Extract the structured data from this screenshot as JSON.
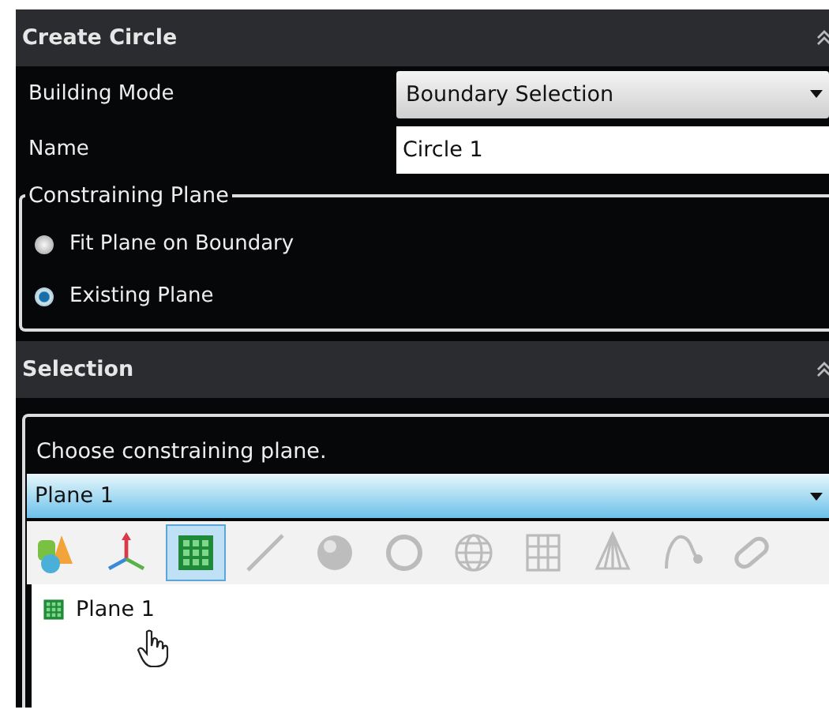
{
  "create_panel": {
    "title": "Create Circle",
    "building_mode": {
      "label": "Building Mode",
      "value": "Boundary Selection"
    },
    "name": {
      "label": "Name",
      "value": "Circle 1"
    },
    "constraining_plane": {
      "legend": "Constraining Plane",
      "options": [
        {
          "label": "Fit Plane on Boundary",
          "selected": false
        },
        {
          "label": "Existing Plane",
          "selected": true
        }
      ]
    }
  },
  "selection_panel": {
    "title": "Selection",
    "prompt": "Choose constraining plane.",
    "plane": {
      "value": "Plane 1"
    },
    "filter_tools": [
      {
        "kind": "solids",
        "selected": false,
        "disabled": false
      },
      {
        "kind": "axes",
        "selected": false,
        "disabled": false
      },
      {
        "kind": "plane",
        "selected": true,
        "disabled": false
      },
      {
        "kind": "line",
        "selected": false,
        "disabled": true
      },
      {
        "kind": "sphere",
        "selected": false,
        "disabled": true
      },
      {
        "kind": "ring",
        "selected": false,
        "disabled": true
      },
      {
        "kind": "globe",
        "selected": false,
        "disabled": true
      },
      {
        "kind": "lattice",
        "selected": false,
        "disabled": true
      },
      {
        "kind": "cone",
        "selected": false,
        "disabled": true
      },
      {
        "kind": "curve",
        "selected": false,
        "disabled": true
      },
      {
        "kind": "loop",
        "selected": false,
        "disabled": true
      }
    ],
    "list_items": [
      {
        "label": "Plane 1"
      }
    ]
  }
}
